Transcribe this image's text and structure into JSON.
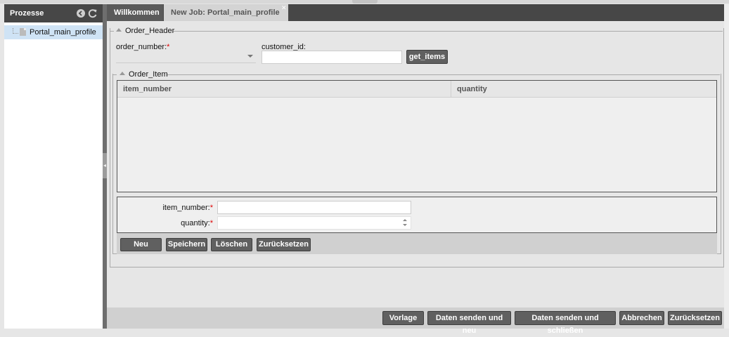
{
  "sidebar": {
    "title": "Prozesse",
    "tree_items": [
      {
        "label": "Portal_main_profile"
      }
    ]
  },
  "tabs": [
    {
      "label": "Willkommen",
      "active": true
    },
    {
      "label": "New Job: Portal_main_profile",
      "active": false
    }
  ],
  "order_header": {
    "legend": "Order_Header",
    "order_number_label": "order_number:",
    "customer_id_label": "customer_id:",
    "customer_id_value": "",
    "get_items_button": "get_items"
  },
  "order_item": {
    "legend": "Order_Item",
    "columns": [
      "item_number",
      "quantity"
    ],
    "rows": [],
    "item_number_label": "item_number:",
    "quantity_label": "quantity:",
    "required_marker": "*",
    "buttons": {
      "neu": "Neu",
      "speichern": "Speichern",
      "loeschen": "Löschen",
      "zuruecksetzen": "Zurücksetzen"
    }
  },
  "bottom_toolbar": {
    "vorlage": "Vorlage",
    "senden_neu": "Daten senden und neu",
    "senden_schliessen": "Daten senden und schließen",
    "abbrechen": "Abbrechen",
    "zuruecksetzen": "Zurücksetzen"
  },
  "colors": {
    "dark_bar": "#474747",
    "button": "#606060",
    "selection": "#cfe3f5",
    "required": "#dd0000"
  }
}
